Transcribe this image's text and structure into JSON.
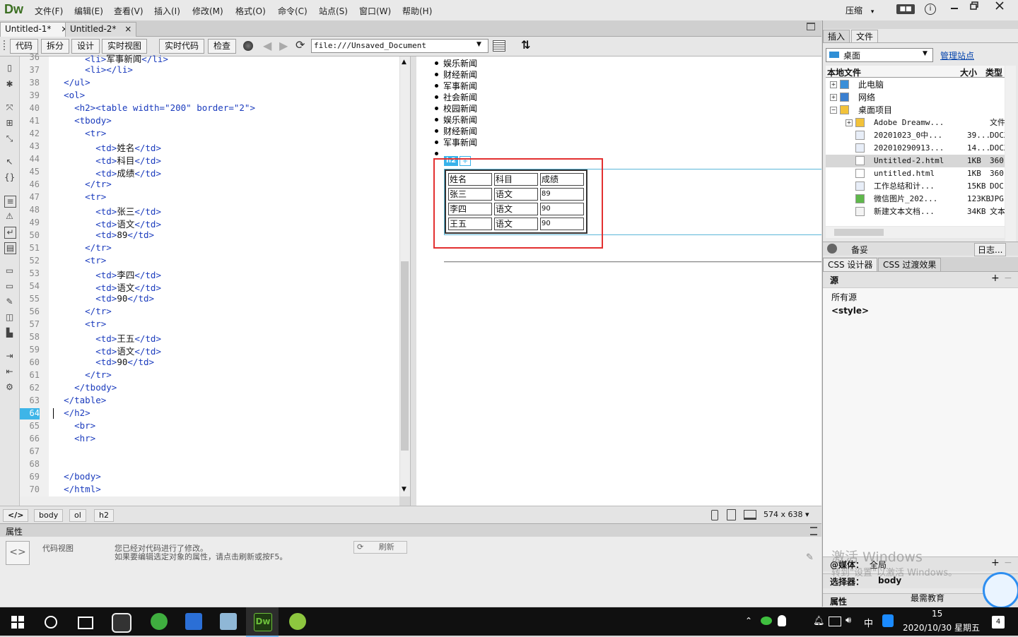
{
  "app": {
    "logo": "Dw",
    "workspace": "压缩",
    "workspace_arrow": "▾"
  },
  "menu": [
    "文件(F)",
    "编辑(E)",
    "查看(V)",
    "插入(I)",
    "修改(M)",
    "格式(O)",
    "命令(C)",
    "站点(S)",
    "窗口(W)",
    "帮助(H)"
  ],
  "doc_tabs": [
    {
      "label": "Untitled-1*",
      "close": "×"
    },
    {
      "label": "Untitled-2*",
      "close": "×"
    }
  ],
  "toolbar": {
    "code": "代码",
    "split": "拆分",
    "design": "设计",
    "live": "实时视图",
    "live_code": "实时代码",
    "inspect": "检查",
    "url": "file:///Unsaved_Document"
  },
  "code_lines": [
    {
      "n": "36",
      "t": "      <li>军事新闻</li>"
    },
    {
      "n": "37",
      "t": "      <li></li>"
    },
    {
      "n": "38",
      "t": "  </ul>"
    },
    {
      "n": "39",
      "t": "  <ol>"
    },
    {
      "n": "40",
      "t": "    <h2><table width=\"200\" border=\"2\">"
    },
    {
      "n": "41",
      "t": "    <tbody>"
    },
    {
      "n": "42",
      "t": "      <tr>"
    },
    {
      "n": "43",
      "t": "        <td>姓名</td>"
    },
    {
      "n": "44",
      "t": "        <td>科目</td>"
    },
    {
      "n": "45",
      "t": "        <td>成绩</td>"
    },
    {
      "n": "46",
      "t": "      </tr>"
    },
    {
      "n": "47",
      "t": "      <tr>"
    },
    {
      "n": "48",
      "t": "        <td>张三</td>"
    },
    {
      "n": "49",
      "t": "        <td>语文</td>"
    },
    {
      "n": "50",
      "t": "        <td>89</td>"
    },
    {
      "n": "51",
      "t": "      </tr>"
    },
    {
      "n": "52",
      "t": "      <tr>"
    },
    {
      "n": "53",
      "t": "        <td>李四</td>"
    },
    {
      "n": "54",
      "t": "        <td>语文</td>"
    },
    {
      "n": "55",
      "t": "        <td>90</td>"
    },
    {
      "n": "56",
      "t": "      </tr>"
    },
    {
      "n": "57",
      "t": "      <tr>"
    },
    {
      "n": "58",
      "t": "        <td>王五</td>"
    },
    {
      "n": "59",
      "t": "        <td>语文</td>"
    },
    {
      "n": "60",
      "t": "        <td>90</td>"
    },
    {
      "n": "61",
      "t": "      </tr>"
    },
    {
      "n": "62",
      "t": "    </tbody>"
    },
    {
      "n": "63",
      "t": "  </table>"
    },
    {
      "n": "64",
      "t": "  </h2>"
    },
    {
      "n": "65",
      "t": "    <br>"
    },
    {
      "n": "66",
      "t": "    <hr>"
    },
    {
      "n": "67",
      "t": ""
    },
    {
      "n": "68",
      "t": ""
    },
    {
      "n": "69",
      "t": "  </body>"
    },
    {
      "n": "70",
      "t": "  </html>"
    }
  ],
  "current_line": "64",
  "design": {
    "list": [
      "娱乐新闻",
      "财经新闻",
      "军事新闻",
      "社会新闻",
      "校园新闻",
      "娱乐新闻",
      "财经新闻",
      "军事新闻",
      ""
    ],
    "tag_chip": "h2",
    "tag_plus": "+",
    "table": [
      [
        "姓名",
        "科目",
        "成绩"
      ],
      [
        "张三",
        "语文",
        "89"
      ],
      [
        "李四",
        "语文",
        "90"
      ],
      [
        "王五",
        "语文",
        "90"
      ]
    ]
  },
  "status": {
    "tags": [
      "body",
      "ol",
      "h2"
    ],
    "window_size": "574 x 638 ▾"
  },
  "properties": {
    "title": "属性",
    "code_view": "代码视图",
    "msg1": "您已经对代码进行了修改。",
    "msg2": "如果要编辑选定对象的属性，请点击刷新或按F5。",
    "refresh": "刷新"
  },
  "files_panel": {
    "tabs": [
      "插入",
      "文件"
    ],
    "location": "桌面",
    "manage": "管理站点",
    "col_local": "本地文件",
    "col_size": "大小",
    "col_type": "类型",
    "rows": [
      {
        "name": "此电脑",
        "size": "",
        "type": "",
        "indent": 1,
        "icon": "computer-icon"
      },
      {
        "name": "网络",
        "size": "",
        "type": "",
        "indent": 1,
        "icon": "network-icon"
      },
      {
        "name": "桌面项目",
        "size": "",
        "type": "",
        "indent": 1,
        "icon": "folder-icon"
      },
      {
        "name": "Adobe Dreamw...",
        "size": "",
        "type": "文件",
        "indent": 2,
        "icon": "folder-icon"
      },
      {
        "name": "20201023_0中...",
        "size": "39...",
        "type": "DOCX",
        "indent": 2,
        "icon": "word-icon"
      },
      {
        "name": "202010290913...",
        "size": "14...",
        "type": "DOCX",
        "indent": 2,
        "icon": "word-icon"
      },
      {
        "name": "Untitled-2.html",
        "size": "1KB",
        "type": "360",
        "indent": 2,
        "icon": "html-icon"
      },
      {
        "name": "untitled.html",
        "size": "1KB",
        "type": "360",
        "indent": 2,
        "icon": "html-icon"
      },
      {
        "name": "工作总结和计...",
        "size": "15KB",
        "type": "DOC",
        "indent": 2,
        "icon": "word-icon"
      },
      {
        "name": "微信图片_202...",
        "size": "123KB",
        "type": "JPG",
        "indent": 2,
        "icon": "image-icon"
      },
      {
        "name": "新建文本文档...",
        "size": "34KB",
        "type": "文本",
        "indent": 2,
        "icon": "text-icon"
      }
    ],
    "backup": "备妥",
    "log": "日志..."
  },
  "css_panel": {
    "tabs": [
      "CSS 设计器",
      "CSS 过渡效果"
    ],
    "sources_title": "源",
    "all_sources": "所有源",
    "style_tag": "<style>",
    "media_label": "@媒体：",
    "media_value": "全局",
    "selector_label": "选择器：",
    "selector_value": "body",
    "props_label": "属性"
  },
  "watermark": {
    "line1": "激活 Windows",
    "line2": "转到\"设置\"以激活 Windows。",
    "brand": "最需教育"
  },
  "clock": {
    "time": "15",
    "date": "2020/10/30 星期五",
    "ime": "中",
    "badge": "4"
  }
}
